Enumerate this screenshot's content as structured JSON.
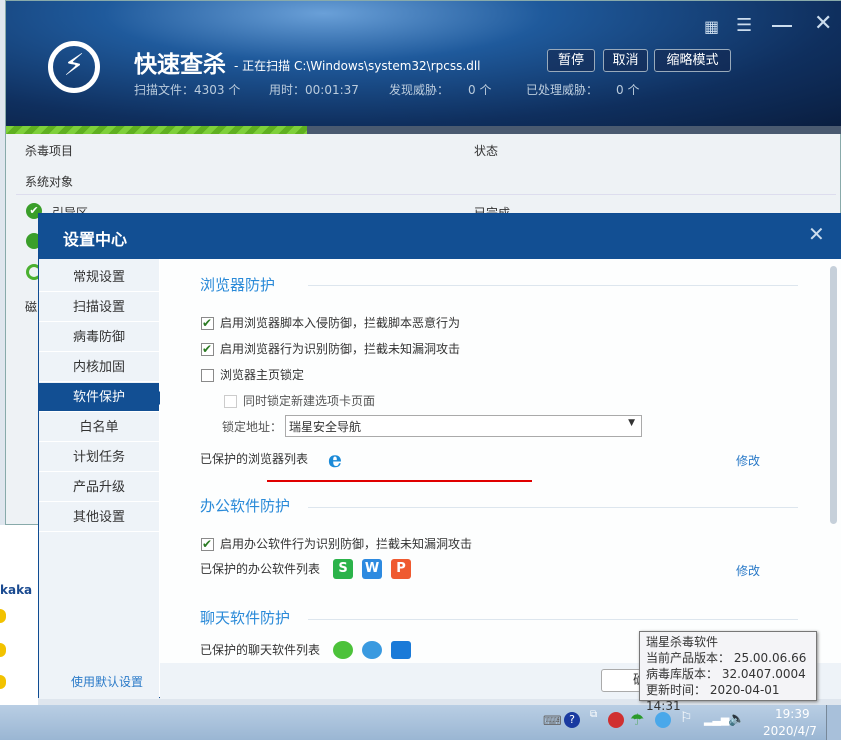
{
  "scan": {
    "title": "快速查杀",
    "status": "- 正在扫描 C:\\Windows\\system32\\rpcss.dll",
    "pause": "暂停",
    "cancel": "取消",
    "mini": "缩略模式",
    "files": "扫描文件：4303 个",
    "time": "用时：00:01:37",
    "threats_label": "发现威胁：",
    "threats": "0 个",
    "handled_label": "已处理威胁：",
    "handled": "0 个",
    "progress_percent": 36,
    "col_item": "杀毒项目",
    "col_status": "状态",
    "group": "系统对象",
    "rows": [
      {
        "name": "引导区",
        "status": "已完成"
      }
    ],
    "partial": "磁"
  },
  "left_bg": {
    "name": "kaka"
  },
  "dialog": {
    "title": "设置中心",
    "sidebar": [
      "常规设置",
      "扫描设置",
      "病毒防御",
      "内核加固",
      "软件保护",
      "白名单",
      "计划任务",
      "产品升级",
      "其他设置"
    ],
    "default_link": "使用默认设置",
    "ok": "确定",
    "browser": {
      "title": "浏览器防护",
      "opt1": "启用浏览器脚本入侵防御，拦截脚本恶意行为",
      "opt2": "启用浏览器行为识别防御，拦截未知漏洞攻击",
      "opt3": "浏览器主页锁定",
      "opt4": "同时锁定新建选项卡页面",
      "lock_label": "锁定地址：",
      "lock_value": "瑞星安全导航",
      "list_label": "已保护的浏览器列表",
      "modify": "修改"
    },
    "office": {
      "title": "办公软件防护",
      "opt1": "启用办公软件行为识别防御，拦截未知漏洞攻击",
      "list_label": "已保护的办公软件列表",
      "modify": "修改",
      "apps": [
        "S",
        "W",
        "P"
      ]
    },
    "chat": {
      "title": "聊天软件防护",
      "list_label": "已保护的聊天软件列表"
    }
  },
  "tooltip": {
    "title": "瑞星杀毒软件",
    "version": "当前产品版本： 25.00.06.66",
    "db": "病毒库版本： 32.0407.0004",
    "updated": "更新时间： 2020-04-01 14:31"
  },
  "taskbar": {
    "time": "19:39",
    "date": "2020/4/7"
  },
  "colors": {
    "accent": "#124f93",
    "link": "#2a8ad8",
    "annotation": "#e00000"
  }
}
